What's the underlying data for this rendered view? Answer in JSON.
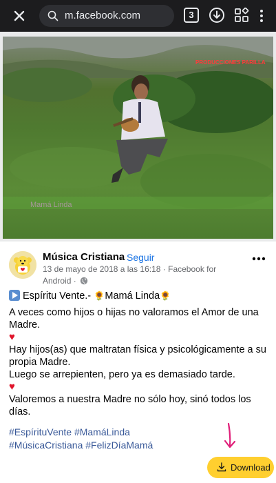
{
  "browser": {
    "url": "m.facebook.com",
    "tab_count": "3",
    "close_icon": "close-icon",
    "search_icon": "search-icon"
  },
  "video": {
    "overlay_text": "Mamá Linda",
    "watermark": "PRODUCCIONES PARILLA"
  },
  "post": {
    "page_name": "Música Cristiana",
    "separator": "·",
    "follow_label": "Seguir",
    "meta_text": "13 de mayo de 2018 a las 16:18 · Facebook for Android ·",
    "body": {
      "title_left": "Espíritu Vente.- ",
      "title_right": "Mamá Linda",
      "line1": "A veces como hijos o hijas no valoramos el Amor de una Madre.",
      "heart1": "♥",
      "line2": "Hay hijos(as) que maltratan física y psicológicamente a su propia Madre.",
      "line3": "Luego se arrepienten, pero ya es demasiado tarde.",
      "heart2": "♥",
      "line4": "Valoremos a nuestra Madre no sólo hoy, sinó todos los días."
    },
    "hashtags_line1": "#EspírituVente #MamáLinda",
    "hashtags_line2": "#MúsicaCristiana #FelizDíaMamá"
  },
  "download": {
    "label": "Download",
    "color": "#ffcf2f",
    "arrow_color": "#e0207a"
  },
  "colors": {
    "link_blue": "#1b74e4",
    "hashtag_blue": "#385898",
    "topbar": "#1c1c1e"
  }
}
